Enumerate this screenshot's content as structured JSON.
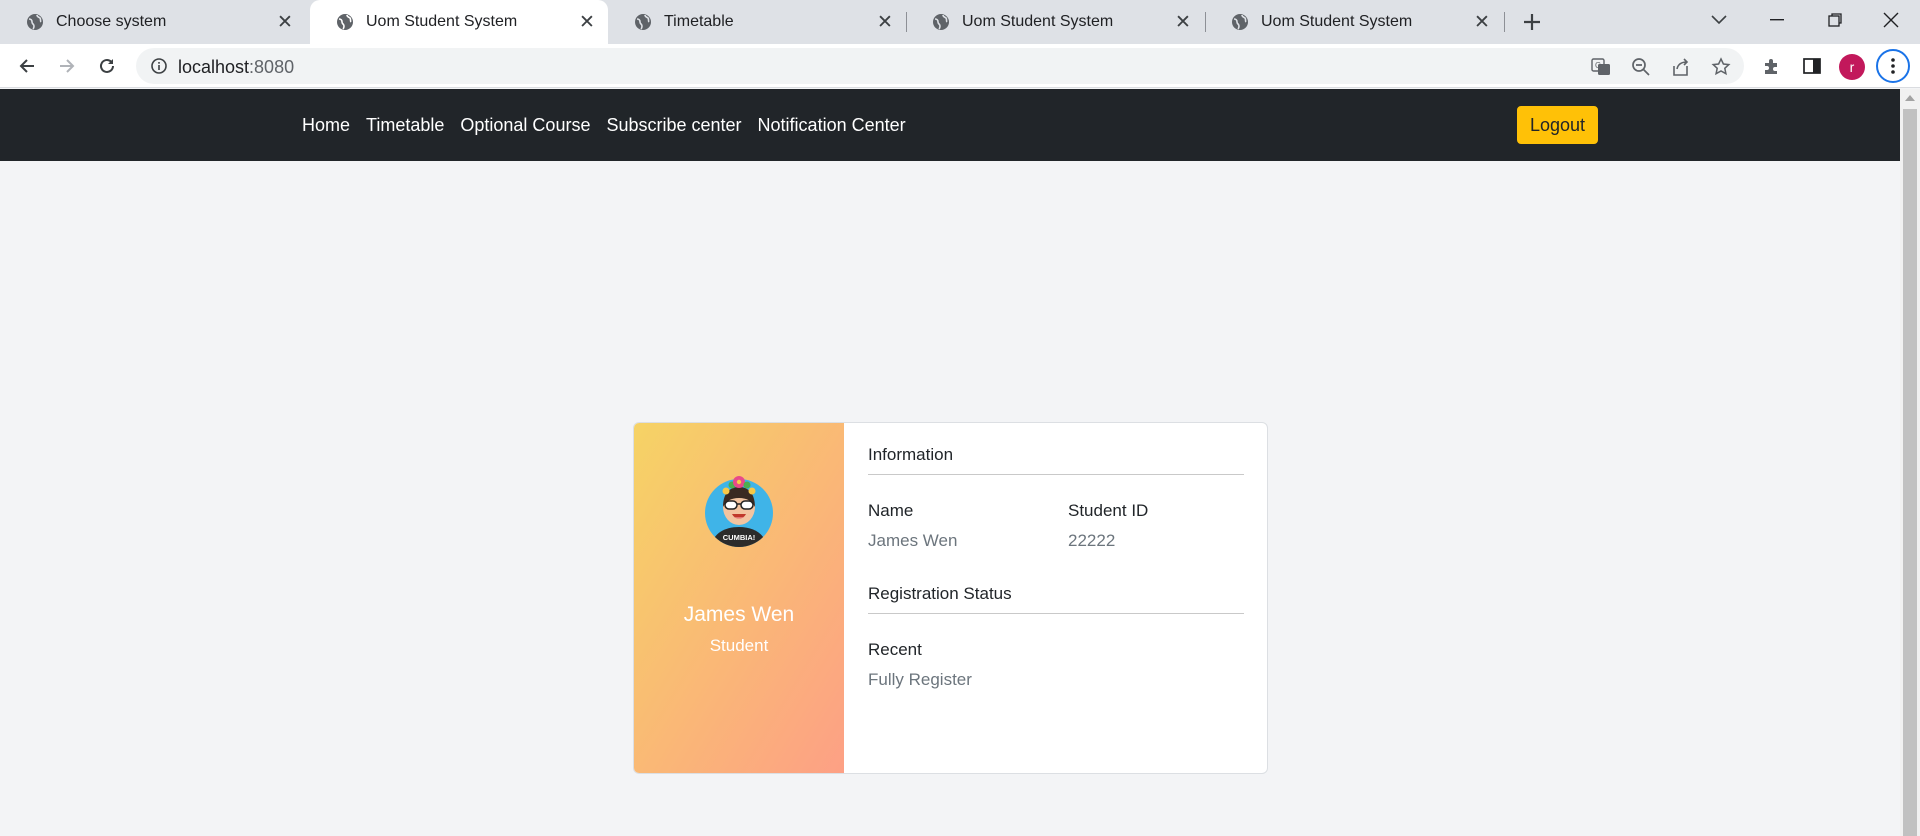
{
  "browser": {
    "tabs": [
      {
        "title": "Choose system",
        "active": false
      },
      {
        "title": "Uom Student System",
        "active": true
      },
      {
        "title": "Timetable",
        "active": false
      },
      {
        "title": "Uom Student System",
        "active": false
      },
      {
        "title": "Uom Student System",
        "active": false
      }
    ],
    "url_host": "localhost",
    "url_port": ":8080",
    "profile_initial": "r"
  },
  "nav": {
    "links": [
      "Home",
      "Timetable",
      "Optional Course",
      "Subscribe center",
      "Notification Center"
    ],
    "logout_label": "Logout"
  },
  "profile_card": {
    "name": "James Wen",
    "role": "Student",
    "information": {
      "title": "Information",
      "name_label": "Name",
      "name_value": "James Wen",
      "id_label": "Student ID",
      "id_value": "22222"
    },
    "registration": {
      "title": "Registration Status",
      "recent_label": "Recent",
      "recent_value": "Fully Register"
    },
    "avatar_text": "CUMBIA!"
  },
  "colors": {
    "navbar": "#212529",
    "logout": "#ffc107",
    "gradient_start": "#f6d365",
    "gradient_end": "#fda085",
    "page_bg": "#f3f4f6"
  }
}
